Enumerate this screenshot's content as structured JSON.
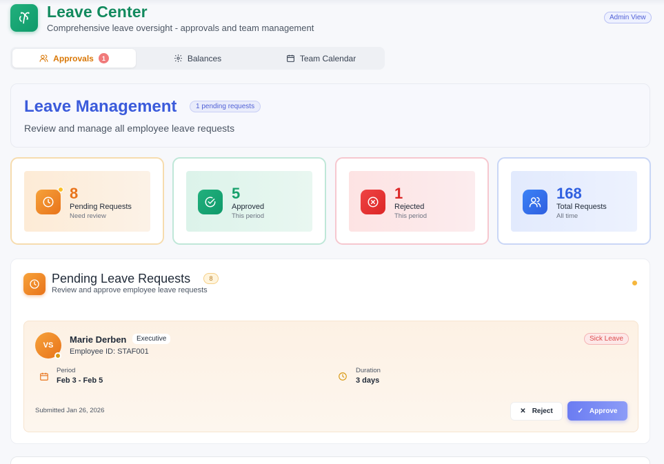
{
  "header": {
    "title": "Leave Center",
    "subtitle": "Comprehensive leave oversight - approvals and team management",
    "admin_badge": "Admin View",
    "logo_icon": "palm-tree-icon"
  },
  "tabs": [
    {
      "label": "Approvals",
      "icon": "users-icon",
      "count": "1",
      "active": true
    },
    {
      "label": "Balances",
      "icon": "gear-icon",
      "active": false
    },
    {
      "label": "Team Calendar",
      "icon": "calendar-icon",
      "active": false
    }
  ],
  "management": {
    "title": "Leave Management",
    "pending_chip": "1 pending requests",
    "subtitle": "Review and manage all employee leave requests"
  },
  "stats": [
    {
      "value": "8",
      "label": "Pending Requests",
      "hint": "Need review",
      "icon": "clock-icon",
      "color": "#e8731a"
    },
    {
      "value": "5",
      "label": "Approved",
      "hint": "This period",
      "icon": "check-circle-icon",
      "color": "#17a06b"
    },
    {
      "value": "1",
      "label": "Rejected",
      "hint": "This period",
      "icon": "x-circle-icon",
      "color": "#dc2626"
    },
    {
      "value": "168",
      "label": "Total Requests",
      "hint": "All time",
      "icon": "users-icon",
      "color": "#2f5fe0"
    }
  ],
  "pending": {
    "title": "Pending Leave Requests",
    "count": "8",
    "subtitle": "Review and approve employee leave requests",
    "requests": [
      {
        "initials": "VS",
        "name": "Marie Derben",
        "role": "Executive",
        "employee_id": "Employee ID: STAF001",
        "leave_type": "Sick Leave",
        "period_label": "Period",
        "period_value": "Feb 3 - Feb 5",
        "duration_label": "Duration",
        "duration_value": "3 days",
        "submitted": "Submitted Jan 26, 2026",
        "reject_label": "Reject",
        "approve_label": "Approve"
      }
    ]
  }
}
